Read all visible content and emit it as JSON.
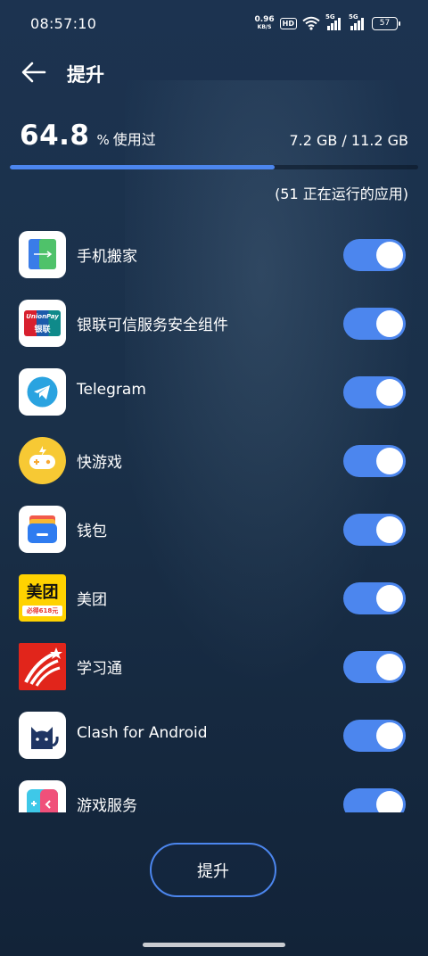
{
  "status_bar": {
    "time": "08:57:10",
    "net_speed_value": "0.96",
    "net_speed_unit": "KB/S",
    "hd_label": "HD",
    "signal1_label": "5G",
    "signal2_label": "5G",
    "battery": "57"
  },
  "header": {
    "title": "提升",
    "back_icon": "arrow-left-icon"
  },
  "memory": {
    "percent": "64.8",
    "percent_sign": "%",
    "used_label": "使用过",
    "usage_fraction": 0.648,
    "summary": "7.2 GB / 11.2 GB",
    "running_apps": "(51 正在运行的应用)"
  },
  "apps": [
    {
      "name": "手机搬家",
      "enabled": true,
      "icon": "phone-clone-icon"
    },
    {
      "name": "银联可信服务安全组件",
      "enabled": true,
      "icon": "unionpay-icon",
      "icon_text_1": "UnionPay",
      "icon_text_2": "银联"
    },
    {
      "name": "Telegram",
      "enabled": true,
      "icon": "telegram-icon"
    },
    {
      "name": "快游戏",
      "enabled": true,
      "icon": "quick-game-icon"
    },
    {
      "name": "钱包",
      "enabled": true,
      "icon": "wallet-icon"
    },
    {
      "name": "美团",
      "enabled": true,
      "icon": "meituan-icon",
      "icon_text_1": "美团",
      "icon_text_2": "必得618元"
    },
    {
      "name": "学习通",
      "enabled": true,
      "icon": "xuexitong-icon"
    },
    {
      "name": "Clash for Android",
      "enabled": true,
      "icon": "clash-cat-icon"
    },
    {
      "name": "游戏服务",
      "enabled": true,
      "icon": "game-service-icon"
    }
  ],
  "action_button": {
    "label": "提升"
  },
  "colors": {
    "accent": "#4c86ee",
    "background": "#1c3350"
  }
}
